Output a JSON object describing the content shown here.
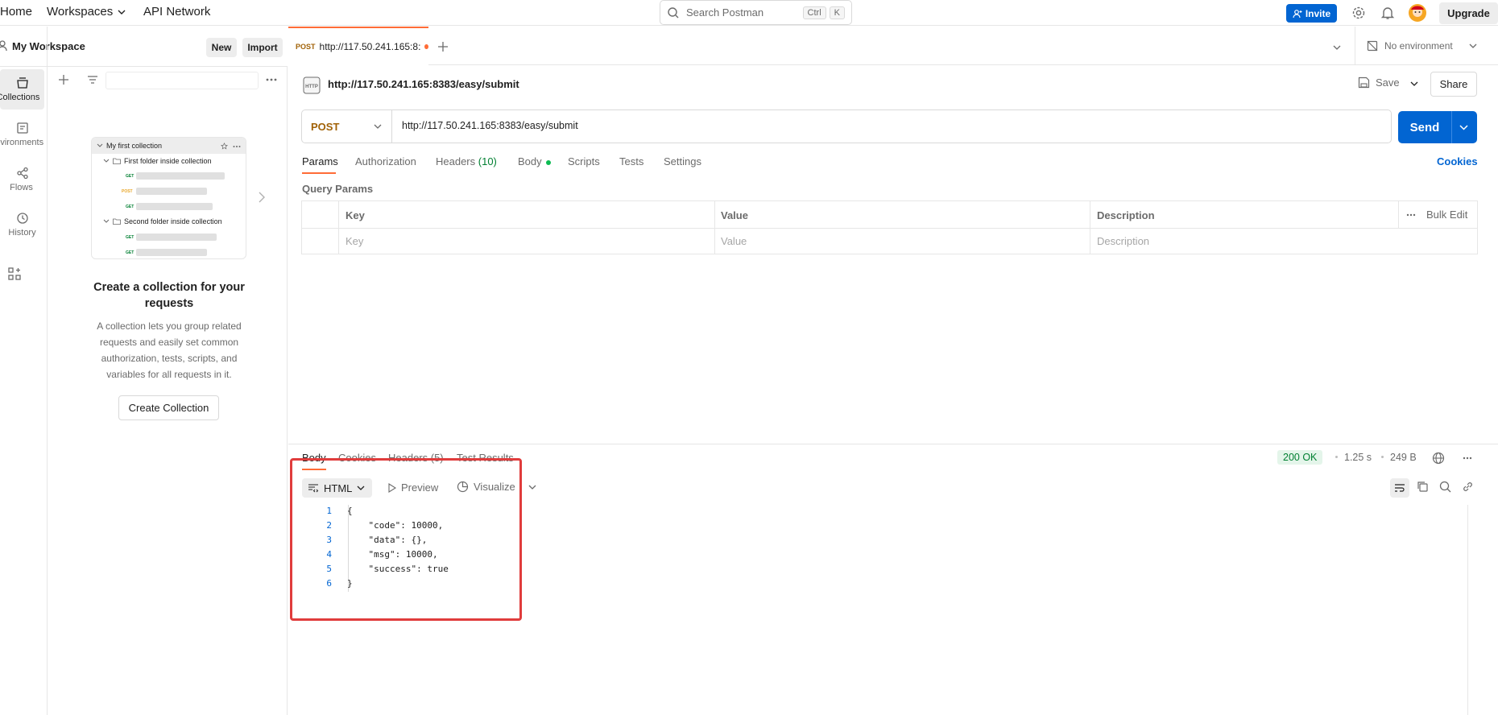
{
  "topnav": {
    "home": "Home",
    "workspaces": "Workspaces",
    "api_network": "API Network",
    "search_placeholder": "Search Postman",
    "kbd_ctrl": "Ctrl",
    "kbd_k": "K",
    "invite": "Invite",
    "upgrade": "Upgrade"
  },
  "workspace": {
    "name": "My Workspace",
    "new": "New",
    "import": "Import"
  },
  "rail": [
    {
      "label": "Collections",
      "icon": "collections-icon",
      "active": true
    },
    {
      "label": "Environments",
      "icon": "environments-icon"
    },
    {
      "label": "Flows",
      "icon": "flows-icon"
    },
    {
      "label": "History",
      "icon": "history-icon"
    }
  ],
  "illustration": {
    "collection": "My first collection",
    "folder1": "First folder inside collection",
    "folder2": "Second folder inside collection",
    "get": "GET",
    "post": "POST"
  },
  "empty_state": {
    "title": "Create a collection for your requests",
    "desc": "A collection lets you group related requests and easily set common authorization, tests, scripts, and variables for all requests in it.",
    "button": "Create Collection"
  },
  "tab": {
    "method": "POST",
    "title": "http://117.50.241.165:8:",
    "environment": "No environment"
  },
  "request": {
    "name": "http://117.50.241.165:8383/easy/submit",
    "save": "Save",
    "share": "Share",
    "method": "POST",
    "url": "http://117.50.241.165:8383/easy/submit",
    "send": "Send",
    "cookies": "Cookies"
  },
  "request_tabs": {
    "params": "Params",
    "authorization": "Authorization",
    "headers": "Headers",
    "headers_count": "(10)",
    "body": "Body",
    "scripts": "Scripts",
    "tests": "Tests",
    "settings": "Settings"
  },
  "params": {
    "section": "Query Params",
    "col_key": "Key",
    "col_value": "Value",
    "col_desc": "Description",
    "bulk_edit": "Bulk Edit",
    "ph_key": "Key",
    "ph_value": "Value",
    "ph_desc": "Description"
  },
  "response": {
    "tabs": [
      "Body",
      "Cookies",
      "Headers (5)",
      "Test Results"
    ],
    "status": "200 OK",
    "time": "1.25 s",
    "size": "249 B",
    "format": "HTML",
    "preview": "Preview",
    "visualize": "Visualize",
    "lines": [
      {
        "n": "1",
        "text": "{"
      },
      {
        "n": "2",
        "text": "    \"code\": 10000,"
      },
      {
        "n": "3",
        "text": "    \"data\": {},"
      },
      {
        "n": "4",
        "text": "    \"msg\": 10000,"
      },
      {
        "n": "5",
        "text": "    \"success\": true"
      },
      {
        "n": "6",
        "text": "}"
      }
    ]
  },
  "colors": {
    "accent": "#ff6c37",
    "primary": "#0265d2",
    "success": "#007f31",
    "highlight": "#e03c3c"
  }
}
